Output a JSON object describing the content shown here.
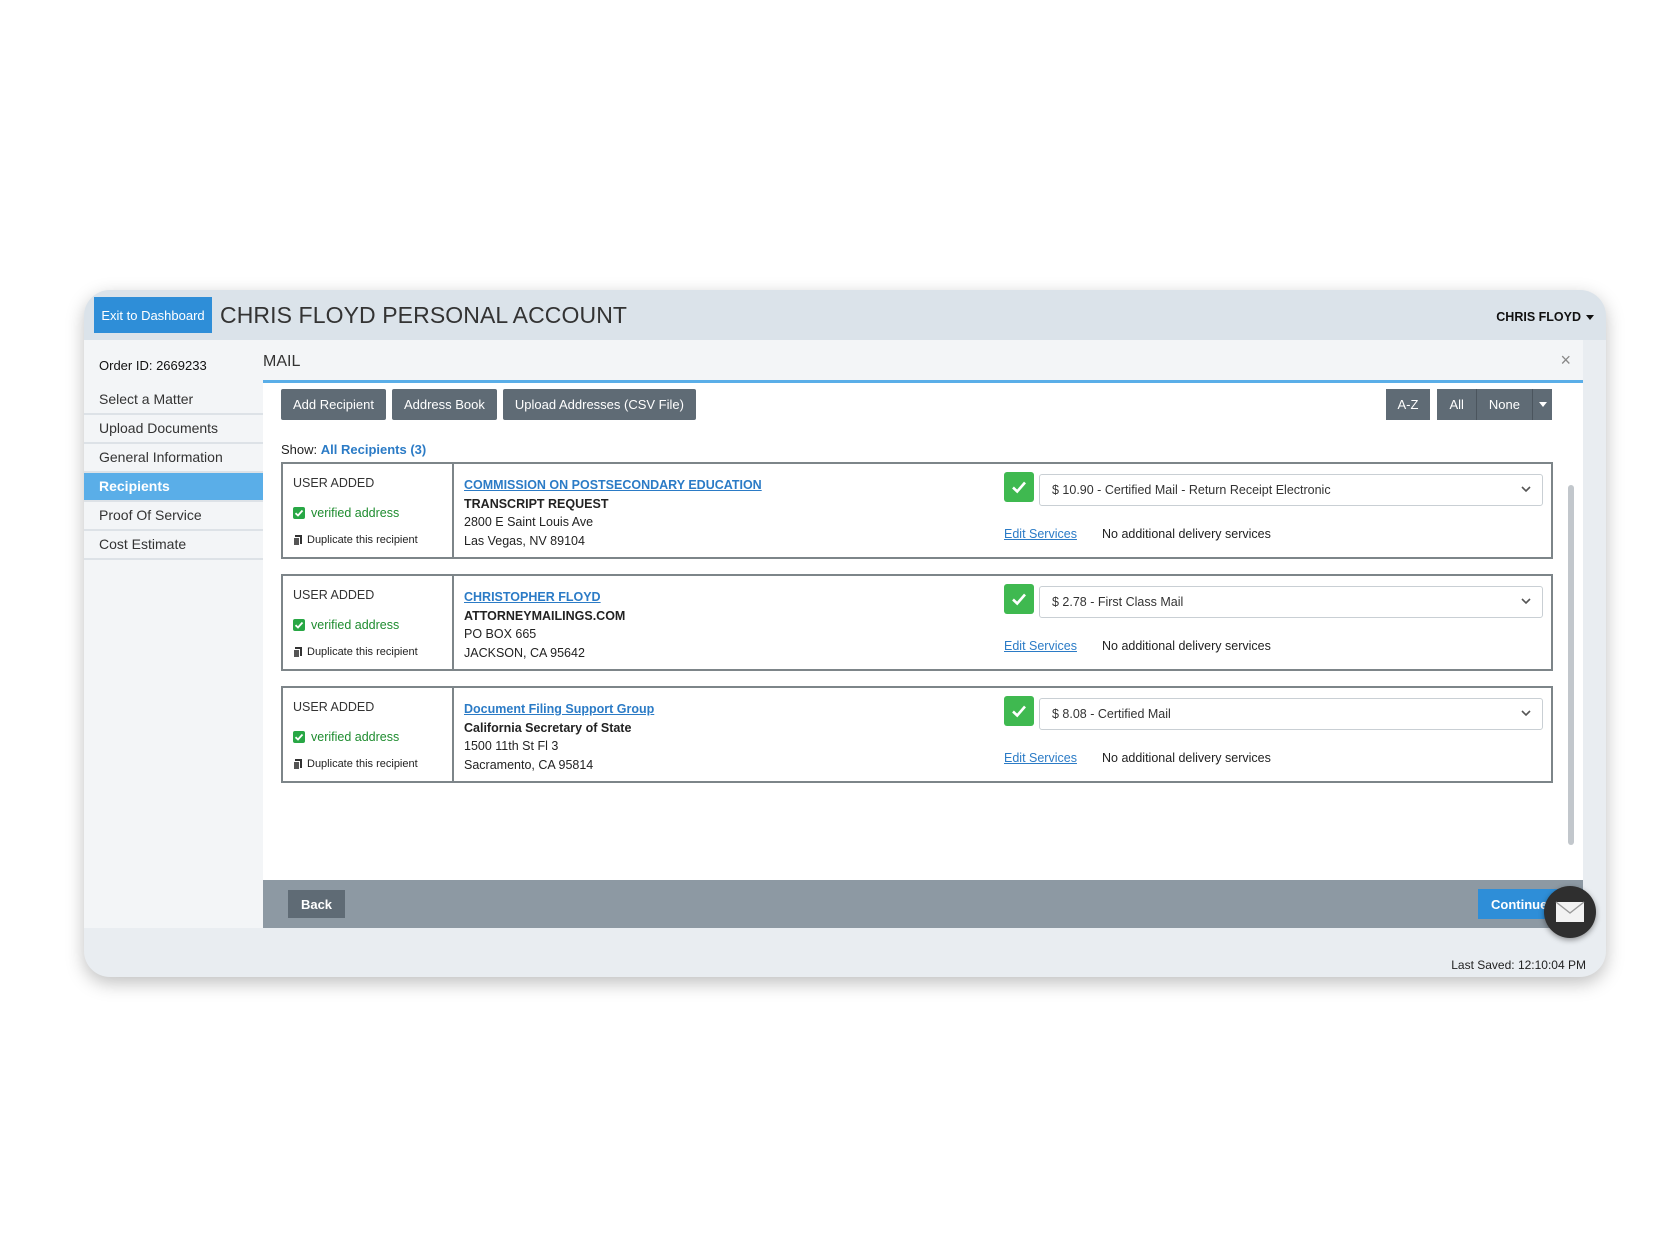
{
  "header": {
    "exit_label": "Exit to Dashboard",
    "account_title": "CHRIS FLOYD PERSONAL ACCOUNT",
    "user_name": "CHRIS FLOYD"
  },
  "sidebar": {
    "order_id": "Order ID: 2669233",
    "items": [
      {
        "label": "Select a Matter"
      },
      {
        "label": "Upload Documents"
      },
      {
        "label": "General Information"
      },
      {
        "label": "Recipients",
        "active": true
      },
      {
        "label": "Proof Of Service"
      },
      {
        "label": "Cost Estimate"
      }
    ]
  },
  "main": {
    "title": "MAIL",
    "close": "×",
    "toolbar": {
      "add_recipient": "Add Recipient",
      "address_book": "Address Book",
      "upload_addresses": "Upload Addresses (CSV File)",
      "sort_az": "A-Z",
      "select_all": "All",
      "select_none": "None"
    },
    "show_label": "Show:",
    "show_filter": "All Recipients (3)",
    "recipients": [
      {
        "source": "USER ADDED",
        "verified": "verified address",
        "duplicate": "Duplicate this recipient",
        "name": "COMMISSION ON POSTSECONDARY EDUCATION",
        "org": "TRANSCRIPT REQUEST",
        "street": "2800 E Saint Louis Ave",
        "city": "Las Vegas, NV 89104",
        "service": "$ 10.90 - Certified Mail - Return Receipt Electronic",
        "edit": "Edit Services",
        "extra": "No additional delivery services"
      },
      {
        "source": "USER ADDED",
        "verified": "verified address",
        "duplicate": "Duplicate this recipient",
        "name": "CHRISTOPHER FLOYD",
        "org": "ATTORNEYMAILINGS.COM",
        "street": "PO BOX 665",
        "city": "JACKSON, CA 95642",
        "service": "$ 2.78 - First Class Mail",
        "edit": "Edit Services",
        "extra": "No additional delivery services"
      },
      {
        "source": "USER ADDED",
        "verified": "verified address",
        "duplicate": "Duplicate this recipient",
        "name": "Document Filing Support Group",
        "org": "California Secretary of State",
        "street": "1500 11th St Fl 3",
        "city": "Sacramento, CA 95814",
        "service": "$ 8.08 - Certified Mail",
        "edit": "Edit Services",
        "extra": "No additional delivery services"
      }
    ],
    "footer": {
      "back": "Back",
      "continue": "Continue"
    }
  },
  "status": {
    "last_saved": "Last Saved: 12:10:04 PM"
  },
  "icons": {
    "check": "check-icon",
    "chevron": "chevron-down-icon",
    "copy": "copy-icon",
    "mail": "mail-icon"
  },
  "colors": {
    "accent": "#2e8ed8",
    "active_nav": "#5aaee8",
    "verified_green": "#1e8c2f",
    "toolbar_button": "#5f6b75",
    "footer_bar": "#8d99a3"
  }
}
